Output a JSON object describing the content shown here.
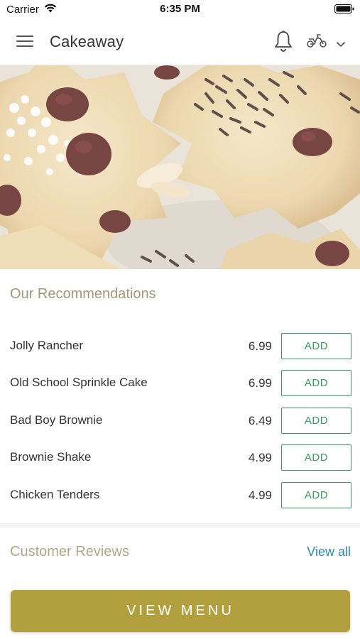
{
  "status_bar": {
    "carrier": "Carrier",
    "time": "6:35 PM"
  },
  "header": {
    "title": "Cakeaway",
    "icons": [
      "menu-icon",
      "bell-icon",
      "scooter-icon",
      "chevron-down-icon"
    ]
  },
  "recommendations": {
    "title": "Our Recommendations",
    "items": [
      {
        "name": "Jolly Rancher",
        "price": "6.99",
        "button": "ADD"
      },
      {
        "name": "Old School Sprinkle Cake",
        "price": "6.99",
        "button": "ADD"
      },
      {
        "name": "Bad Boy Brownie",
        "price": "6.49",
        "button": "ADD"
      },
      {
        "name": "Brownie Shake",
        "price": "4.99",
        "button": "ADD"
      },
      {
        "name": "Chicken Tenders",
        "price": "4.99",
        "button": "ADD"
      }
    ]
  },
  "reviews": {
    "title": "Customer Reviews",
    "view_all": "View all"
  },
  "footer": {
    "view_menu": "VIEW MENU"
  },
  "colors": {
    "accent_gold": "#b2a03f",
    "add_green": "#3a9b5d",
    "link_blue": "#2a8ab8",
    "section_title": "#a39878"
  }
}
